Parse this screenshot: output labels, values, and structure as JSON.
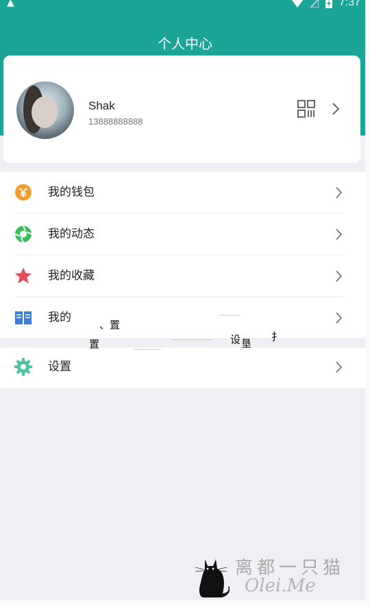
{
  "status_bar": {
    "time": "7:37",
    "icons": [
      "warning-icon",
      "wifi-icon",
      "no-signal-icon",
      "battery-charging-icon"
    ]
  },
  "header": {
    "title": "个人中心",
    "background_color": "#1aa597"
  },
  "profile": {
    "name": "Shak",
    "phone": "13888888888",
    "icons": [
      "avatar",
      "qr-code-icon",
      "chevron-right-icon"
    ]
  },
  "menu": {
    "items": [
      {
        "label": "我的钱包",
        "icon": "wallet-yen-icon",
        "icon_color": "#f0a030"
      },
      {
        "label": "我的动态",
        "icon": "camera-shutter-icon",
        "icon_color": "#3bbd5a"
      },
      {
        "label": "我的收藏",
        "icon": "star-icon",
        "icon_color": "#e84a5f"
      },
      {
        "label": "我的",
        "icon": "book-icon",
        "icon_color": "#3a7fe0"
      },
      {
        "label": "设置",
        "icon": "gear-icon",
        "icon_color": "#4fc2a6"
      }
    ]
  },
  "artifacts": {
    "a1": "、置",
    "a2": "置",
    "a3": "设",
    "a4": "垦",
    "a5": "扌"
  },
  "watermark": {
    "title": "离都一只猫",
    "subtitle": "Olei.Me"
  }
}
